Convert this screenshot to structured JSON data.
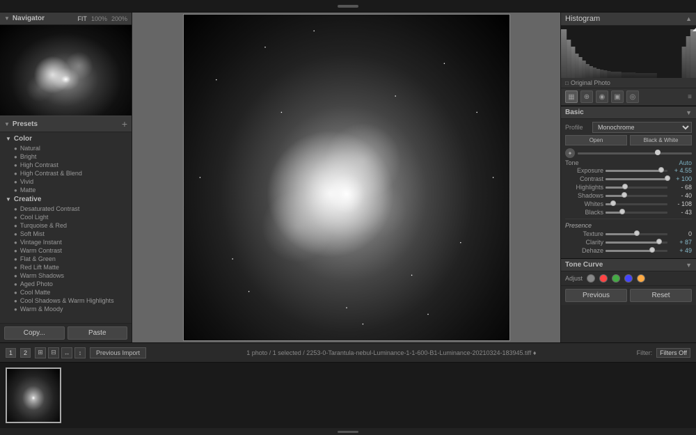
{
  "top_handle": "",
  "left_panel": {
    "navigator": {
      "title": "Navigator",
      "zoom_fit": "FIT",
      "zoom_100": "100%",
      "zoom_200": "200%"
    },
    "presets": {
      "title": "Presets",
      "groups": [
        {
          "name": "Color",
          "items": [
            "Natural",
            "Bright",
            "High Contrast",
            "High Contrast & Blend",
            "Vivid",
            "Matte"
          ]
        },
        {
          "name": "Creative",
          "items": [
            "Desaturated Contrast",
            "Cool Light",
            "Turquoise & Red",
            "Soft Mist",
            "Vintage Instant",
            "Warm Contrast",
            "Flat & Green",
            "Red Lift Matte",
            "Warm Shadows",
            "Aged Photo",
            "Cool Matte",
            "Cool Shadows & Warm Highlights",
            "Warm & Moody"
          ]
        }
      ],
      "copy_btn": "Copy...",
      "paste_btn": "Paste"
    }
  },
  "right_panel": {
    "histogram": {
      "title": "Histogram"
    },
    "original_photo": "Original Photo",
    "basic": {
      "title": "Basic",
      "profile_label": "Profile",
      "profile_value": "Monochrome",
      "open_label": "Open",
      "black_white_label": "Black & White",
      "tone": {
        "label": "Tone",
        "auto": "Auto",
        "exposure_label": "Exposure",
        "exposure_value": "+ 4.55",
        "contrast_label": "Contrast",
        "contrast_value": "+ 100",
        "highlights_label": "Highlights",
        "highlights_value": "- 68",
        "shadows_label": "Shadows",
        "shadows_value": "- 40",
        "whites_label": "Whites",
        "whites_value": "- 108",
        "blacks_label": "Blacks",
        "blacks_value": "- 43"
      },
      "presence": {
        "label": "Presence",
        "texture_label": "Texture",
        "texture_value": "0",
        "clarity_label": "Clarity",
        "clarity_value": "+ 87",
        "dehaze_label": "Dehaze",
        "dehaze_value": "+ 49"
      }
    },
    "tone_curve": {
      "title": "Tone Curve",
      "adjust_label": "Adjust",
      "colors": [
        "#888",
        "#f44",
        "#4a4",
        "#44f",
        "#fa4"
      ]
    },
    "prev_btn": "Previous",
    "reset_btn": "Reset"
  },
  "bottom_nav": {
    "page1": "1",
    "page2": "2",
    "nav_icons": [
      "⊞",
      "⊟",
      "↔",
      "↕"
    ],
    "prev_import": "Previous Import",
    "status": "1 photo / 1 selected / 2253-0-Tarantula-nebul-Luminance-1-1-600-B1-Luminance-20210324-183945.tiff ♦",
    "filter_label": "Filter:",
    "filter_value": "Filters Off"
  }
}
